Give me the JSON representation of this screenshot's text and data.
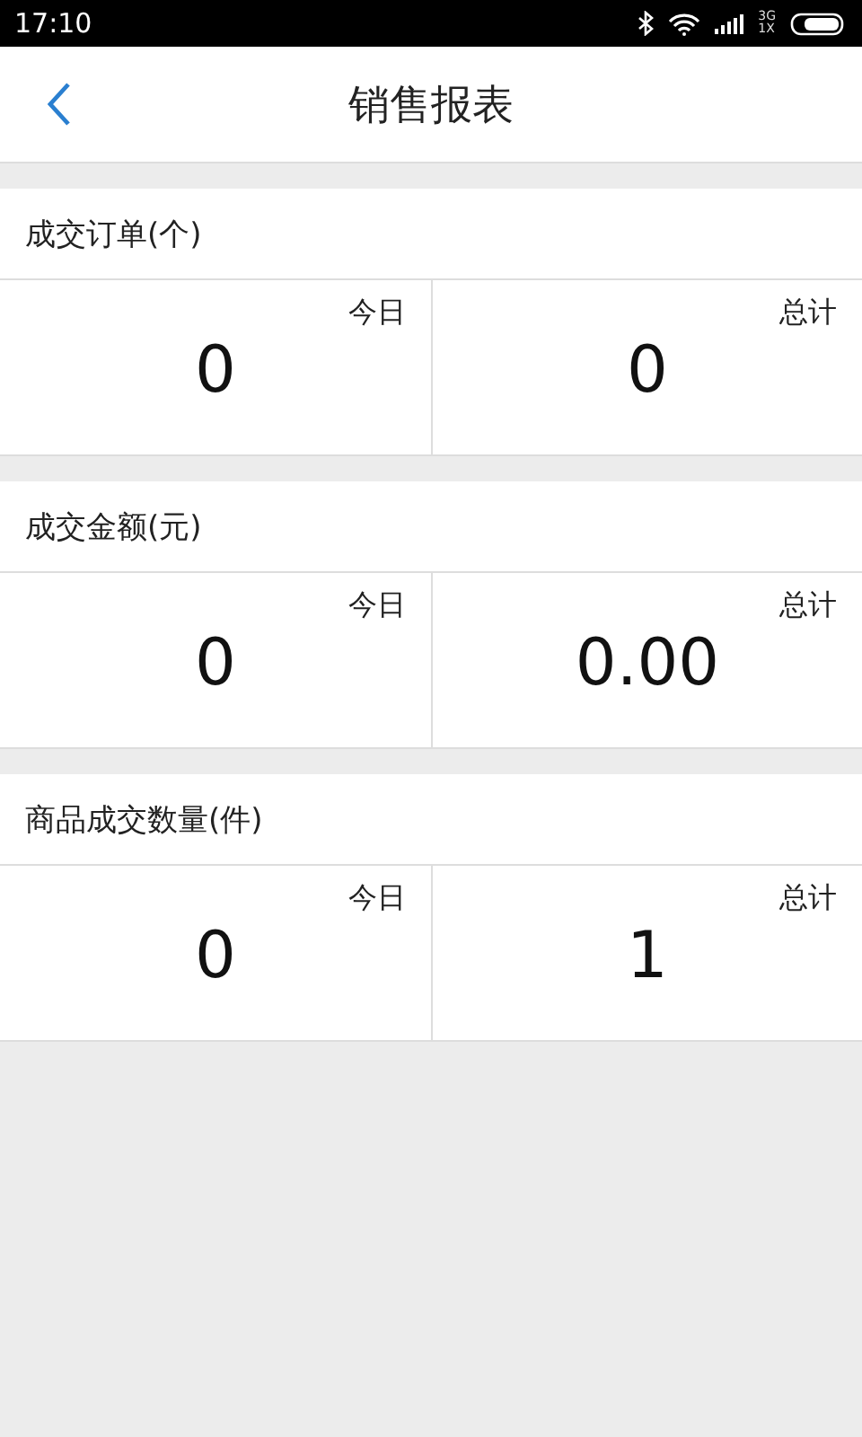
{
  "status_bar": {
    "time": "17:10",
    "network_top": "3G",
    "network_bottom": "1X"
  },
  "header": {
    "title": "销售报表"
  },
  "sections": [
    {
      "title": "成交订单(个)",
      "cells": [
        {
          "label": "今日",
          "value": "0"
        },
        {
          "label": "总计",
          "value": "0"
        }
      ]
    },
    {
      "title": "成交金额(元)",
      "cells": [
        {
          "label": "今日",
          "value": "0"
        },
        {
          "label": "总计",
          "value": "0.00"
        }
      ]
    },
    {
      "title": "商品成交数量(件)",
      "cells": [
        {
          "label": "今日",
          "value": "0"
        },
        {
          "label": "总计",
          "value": "1"
        }
      ]
    }
  ]
}
